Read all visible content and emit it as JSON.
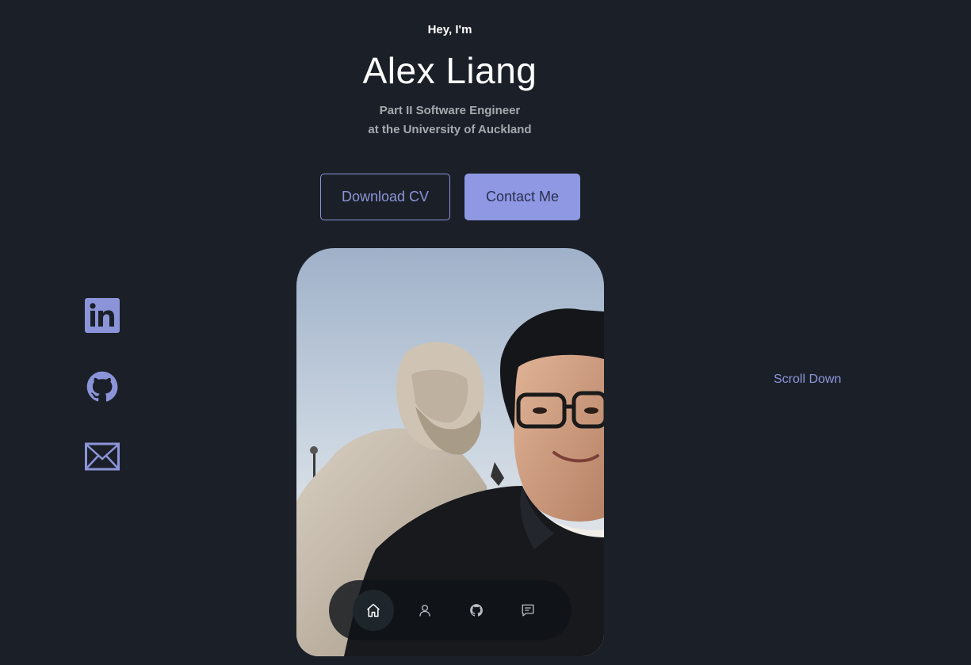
{
  "hero": {
    "greeting": "Hey, I'm",
    "name": "Alex Liang",
    "subtitle_line1": "Part II Software Engineer",
    "subtitle_line2": "at the University of Auckland"
  },
  "actions": {
    "download_cv": "Download CV",
    "contact_me": "Contact Me"
  },
  "socials": [
    {
      "icon": "linkedin-icon"
    },
    {
      "icon": "github-icon"
    },
    {
      "icon": "mail-icon"
    }
  ],
  "scroll_down": "Scroll Down",
  "bottom_nav": {
    "items": [
      {
        "icon": "home-icon",
        "active": true
      },
      {
        "icon": "user-icon",
        "active": false
      },
      {
        "icon": "github-icon",
        "active": false
      },
      {
        "icon": "message-icon",
        "active": false
      }
    ]
  },
  "colors": {
    "background": "#1b2028",
    "accent": "#8c94d9",
    "primary_button": "#8e98e3",
    "heading": "#ffffff",
    "muted_text": "#a6a9ad"
  }
}
